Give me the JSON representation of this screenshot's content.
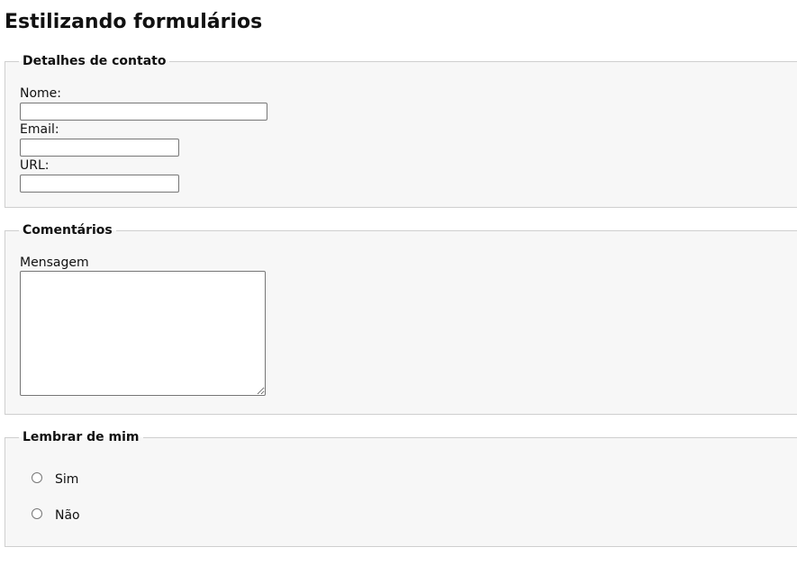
{
  "page": {
    "title": "Estilizando formulários"
  },
  "contact": {
    "legend": "Detalhes de contato",
    "name_label": "Nome:",
    "name_value": "",
    "email_label": "Email:",
    "email_value": "",
    "url_label": "URL:",
    "url_value": ""
  },
  "comments": {
    "legend": "Comentários",
    "message_label": "Mensagem",
    "message_value": ""
  },
  "remember": {
    "legend": "Lembrar de mim",
    "options": [
      {
        "label": "Sim",
        "checked": false
      },
      {
        "label": "Não",
        "checked": false
      }
    ]
  }
}
